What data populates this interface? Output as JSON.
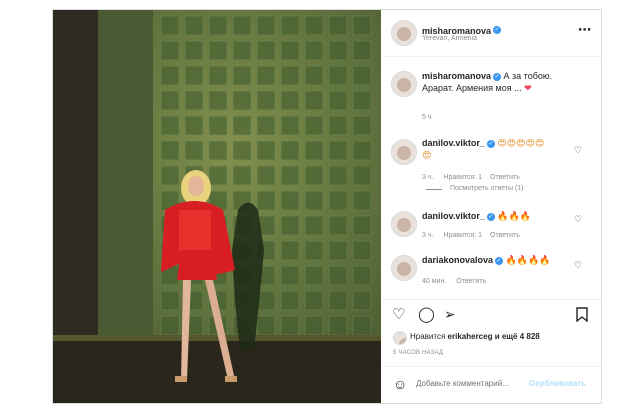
{
  "post": {
    "author": "misharomanova",
    "location": "Yerevan, Armenia",
    "caption_lines": [
      "А за тобою.",
      "Арарат. Армения моя ..."
    ],
    "caption_time": "5 ч"
  },
  "comments": [
    {
      "user": "danilov.viktor_",
      "text": "😍😍😍😍😍",
      "text2": "😍",
      "time": "3 ч.",
      "likes": "Нравится: 1",
      "reply": "Ответить"
    },
    {
      "user": "danilov.viktor_",
      "text": "🔥🔥🔥",
      "time": "3 ч.",
      "likes": "Нравится: 1",
      "reply": "Ответить"
    },
    {
      "user": "dariakonovalova",
      "text": "🔥🔥🔥🔥",
      "time": "40 мин.",
      "reply": "Ответить"
    }
  ],
  "view_replies": "Посмотреть ответы (1)",
  "likes_line": {
    "prefix": "Нравится",
    "user": "erikaherceg",
    "suffix": "и ещё 4 828"
  },
  "post_age": "5 ЧАСОВ НАЗАД",
  "comment_input": {
    "placeholder": "Добавьте комментарий...",
    "post_label": "Опубликовать"
  },
  "icons": {
    "more": "more-icon",
    "heart": "heart-icon",
    "comment": "comment-icon",
    "share": "share-icon",
    "bookmark": "bookmark-icon",
    "emoji": "emoji-icon"
  }
}
